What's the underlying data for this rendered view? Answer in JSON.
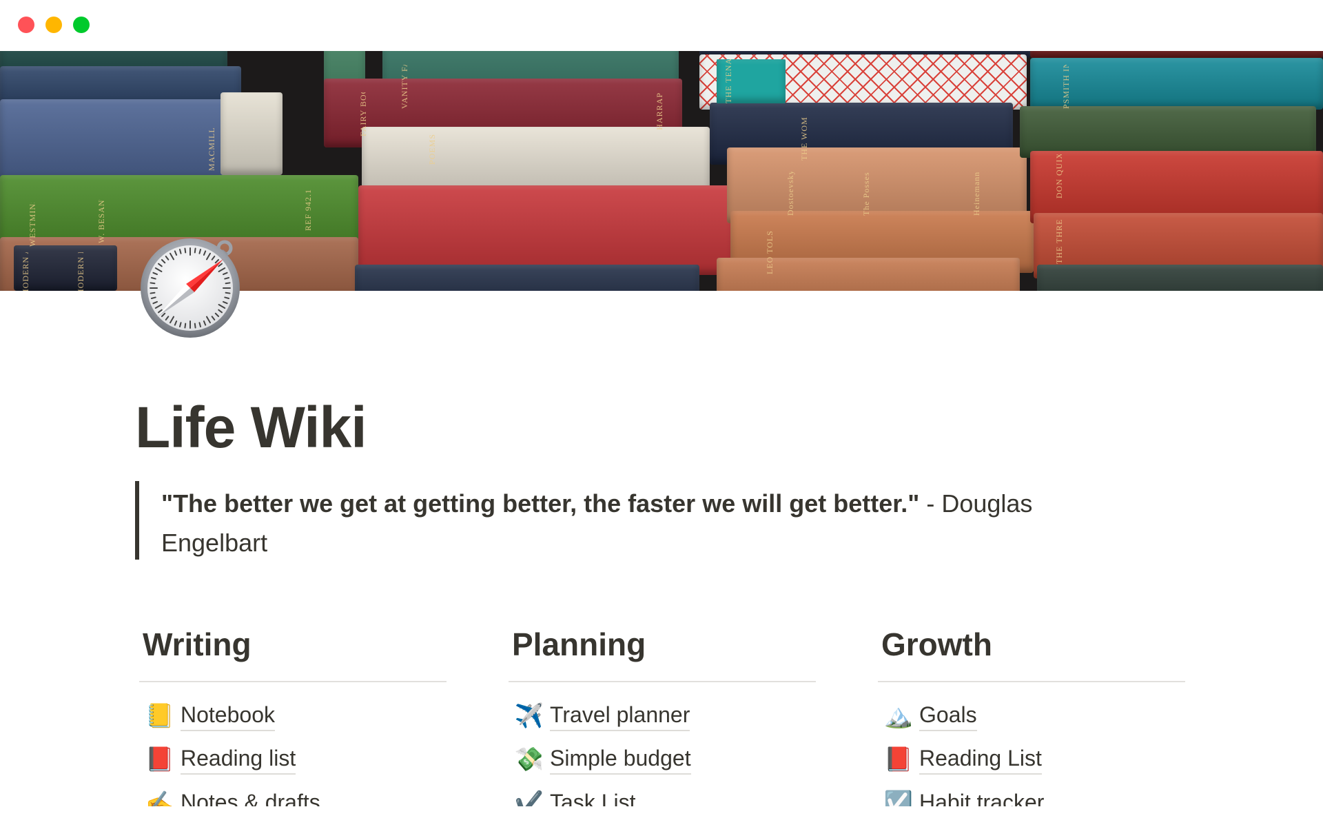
{
  "window": {
    "controls": [
      "close",
      "minimize",
      "maximize"
    ],
    "colors": {
      "close": "#ff5257",
      "minimize": "#ffb600",
      "maximize": "#00ca2c"
    }
  },
  "banner": {
    "description": "Cover image of stacked vintage books",
    "spine_labels": [
      "MACMILLAN",
      "W. BESANT",
      "REF 942.1",
      "WESTMINSTER",
      "VANITY FAIR",
      "FAIRY BOOK",
      "HARRAP",
      "POEMS",
      "THE TENANT OF WILDFELL HALL",
      "THE WOMAN IN WHITE",
      "Dostoevsky",
      "The Possessed",
      "Heinemann",
      "PSMITH IN THE CITY",
      "DON QUIXOTE",
      "THE THREE MUSKETEERS",
      "LEO TOLSTOY",
      "MODERN AMERICAN POETRY",
      "MODERN BRITISH POETRY"
    ]
  },
  "page": {
    "icon": "compass-icon",
    "title": "Life Wiki",
    "quote": {
      "text_bold": "\"The better we get at getting better, the faster we will get better.\"",
      "attribution": " - Douglas Engelbart"
    }
  },
  "columns": [
    {
      "heading": "Writing",
      "items": [
        {
          "emoji": "📒",
          "icon": "notebook-icon",
          "label": "Notebook"
        },
        {
          "emoji": "📕",
          "icon": "red-book-icon",
          "label": "Reading list"
        },
        {
          "emoji": "✍️",
          "icon": "writing-hand-icon",
          "label": "Notes & drafts"
        }
      ]
    },
    {
      "heading": "Planning",
      "items": [
        {
          "emoji": "✈️",
          "icon": "airplane-icon",
          "label": "Travel planner"
        },
        {
          "emoji": "💸",
          "icon": "money-with-wings-icon",
          "label": "Simple budget"
        },
        {
          "emoji": "✔️",
          "icon": "check-mark-icon",
          "label": "Task List"
        }
      ]
    },
    {
      "heading": "Growth",
      "items": [
        {
          "emoji": "🏔️",
          "icon": "mountain-icon",
          "label": "Goals"
        },
        {
          "emoji": "📕",
          "icon": "red-book-icon",
          "label": "Reading List"
        },
        {
          "emoji": "☑️",
          "icon": "checkbox-icon",
          "label": "Habit tracker"
        }
      ]
    }
  ]
}
